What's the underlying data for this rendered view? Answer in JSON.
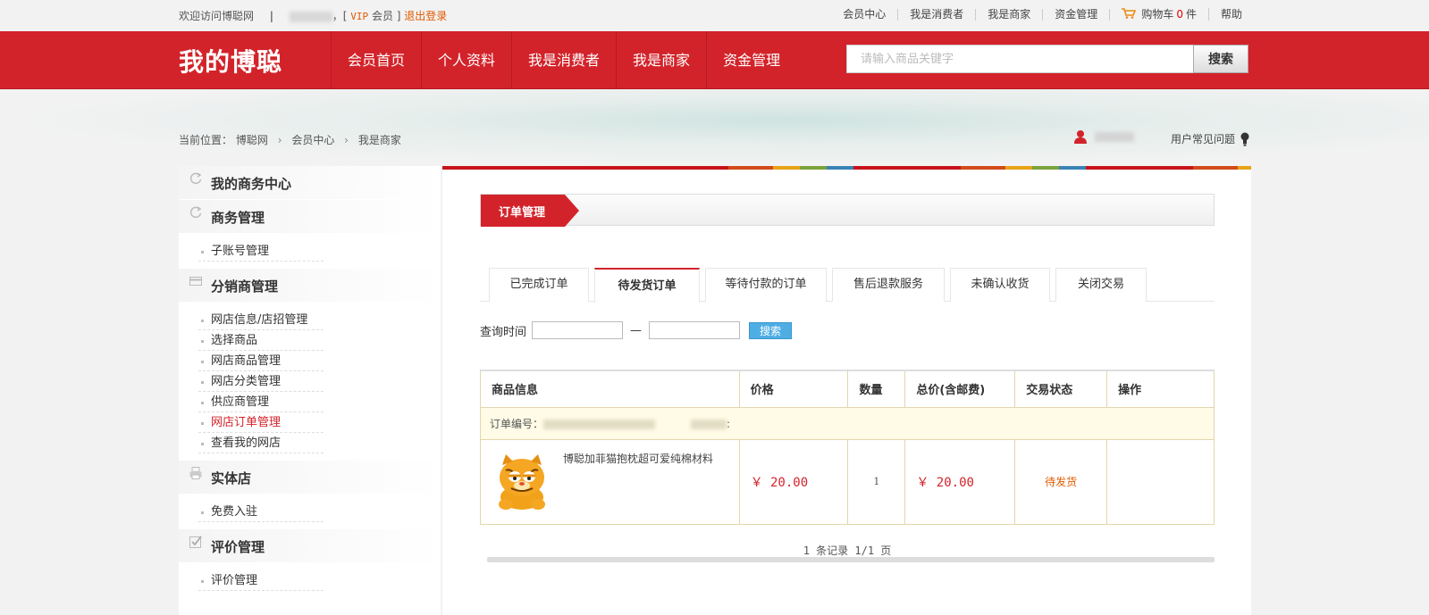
{
  "topbar": {
    "welcome": "欢迎访问博聪网",
    "divider": "|",
    "bracket_open": "，[",
    "vip": "VIP",
    "member": "会员",
    "bracket_close": "]",
    "logout": "退出登录",
    "links": [
      "会员中心",
      "我是消费者",
      "我是商家",
      "资金管理"
    ],
    "cart_label": "购物车",
    "cart_count": "0",
    "cart_unit": "件",
    "help": "帮助"
  },
  "nav": {
    "logo": "我的博聪",
    "items": [
      "会员首页",
      "个人资料",
      "我是消费者",
      "我是商家",
      "资金管理"
    ],
    "search_placeholder": "请输入商品关键字",
    "search_button": "搜索"
  },
  "breadcrumb": {
    "prefix": "当前位置：",
    "items": [
      "博聪网",
      "会员中心",
      "我是商家"
    ],
    "arrow": "›"
  },
  "user": {
    "faq": "用户常见问题"
  },
  "sidebar": {
    "sections": [
      {
        "title": "我的商务中心",
        "icon": "refresh-icon",
        "items": []
      },
      {
        "title": "商务管理",
        "icon": "refresh-icon",
        "items": [
          "子账号管理"
        ]
      },
      {
        "title": "分销商管理",
        "icon": "card-icon",
        "items": [
          "网店信息/店招管理",
          "选择商品",
          "网店商品管理",
          "网店分类管理",
          "供应商管理",
          "网店订单管理",
          "查看我的网店"
        ]
      },
      {
        "title": "实体店",
        "icon": "printer-icon",
        "items": [
          "免费入驻"
        ]
      },
      {
        "title": "评价管理",
        "icon": "checkbox-icon",
        "items": [
          "评价管理"
        ]
      }
    ],
    "active_item": "网店订单管理"
  },
  "main": {
    "title": "订单管理",
    "tabs": [
      "已完成订单",
      "待发货订单",
      "等待付款的订单",
      "售后退款服务",
      "未确认收货",
      "关闭交易"
    ],
    "active_tab": "待发货订单",
    "query": {
      "label": "查询时间",
      "dash": "—",
      "button": "搜索"
    },
    "table": {
      "headers": [
        "商品信息",
        "价格",
        "数量",
        "总价(含邮费)",
        "交易状态",
        "操作"
      ],
      "order_no_label": "订单编号：",
      "order_no_suffix": ":",
      "rows": [
        {
          "product": "博聪加菲猫抱枕超可爱纯棉材料",
          "price": "￥ 20.00",
          "qty": "1",
          "total": "￥ 20.00",
          "status": "待发货",
          "action": ""
        }
      ]
    },
    "pager": "1 条记录 1/1 页"
  },
  "colors": {
    "brand_red": "#d3232a",
    "status_orange": "#e05a00",
    "search_blue": "#4eaee4"
  }
}
